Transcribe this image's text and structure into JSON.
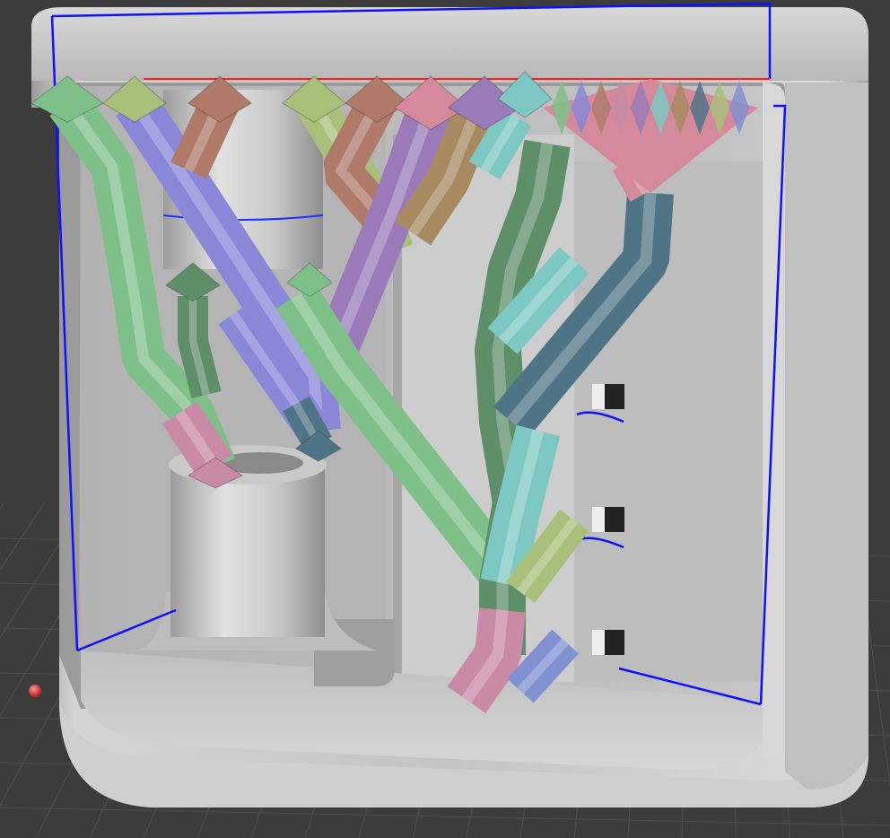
{
  "viewport": {
    "background_color": "#3c3c3c",
    "grid_color": "#4c4c4c",
    "selection_outline_color": "#1010ff",
    "origin_marker_color": "#e03030"
  },
  "model": {
    "frame_color": "#c9c9c9",
    "support_palette": [
      "#7fc08a",
      "#8a86d8",
      "#b07a6a",
      "#c98aa6",
      "#9a7ab8",
      "#7ec8c4",
      "#a88a60",
      "#4f7486",
      "#a8c07a",
      "#8090d0",
      "#d48a9a",
      "#5f8f68"
    ]
  }
}
